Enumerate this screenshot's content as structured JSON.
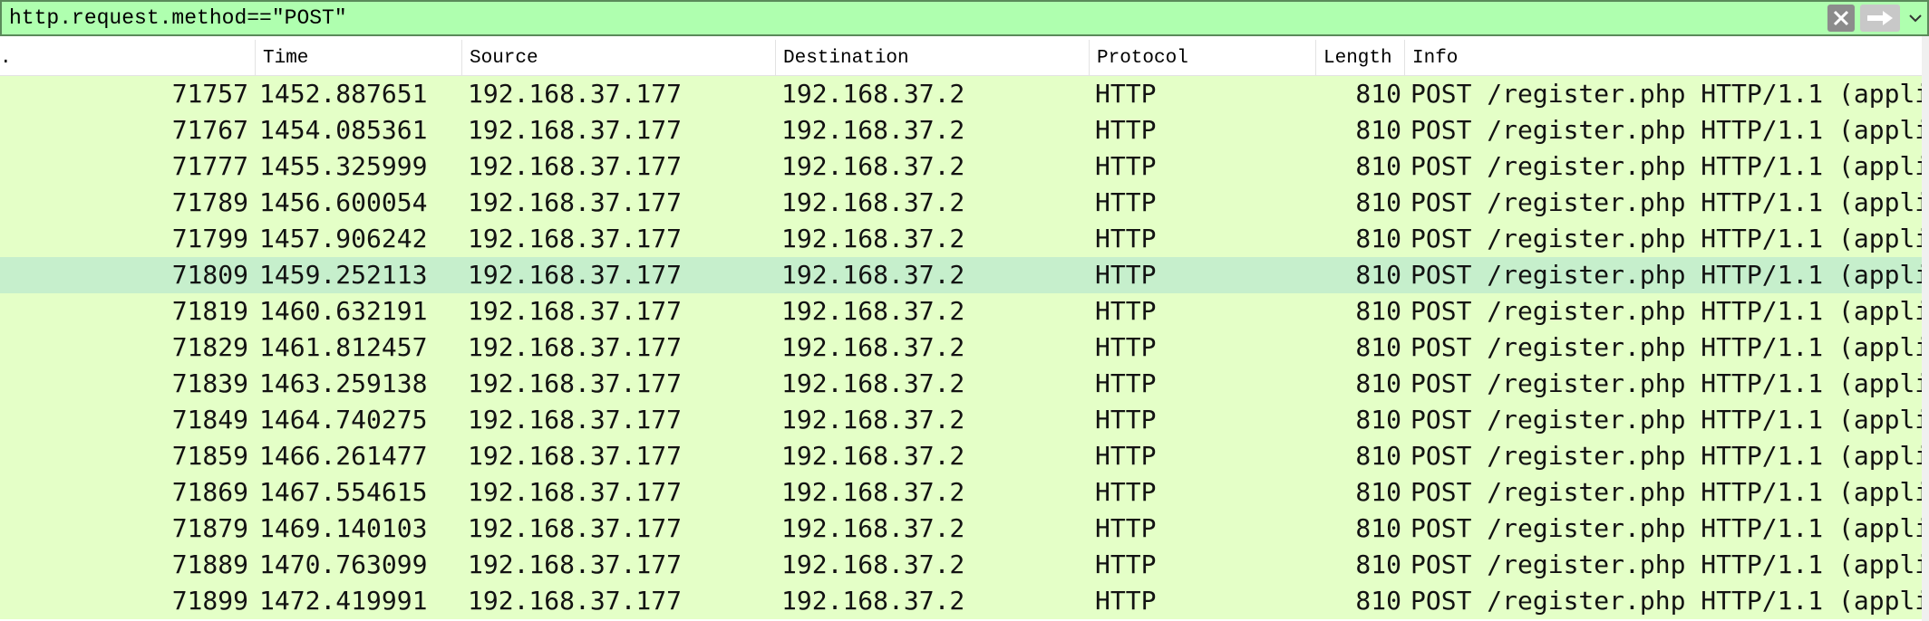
{
  "filter": {
    "value": "http.request.method==\"POST\""
  },
  "columns": [
    "No.",
    "Time",
    "Source",
    "Destination",
    "Protocol",
    "Length",
    "Info"
  ],
  "header_no_visible": ".",
  "selected_index": 5,
  "packets": [
    {
      "no": "71757",
      "time": "1452.887651",
      "source": "192.168.37.177",
      "destination": "192.168.37.2",
      "protocol": "HTTP",
      "length": "810",
      "info": "POST /register.php HTTP/1.1  (appli"
    },
    {
      "no": "71767",
      "time": "1454.085361",
      "source": "192.168.37.177",
      "destination": "192.168.37.2",
      "protocol": "HTTP",
      "length": "810",
      "info": "POST /register.php HTTP/1.1  (appli"
    },
    {
      "no": "71777",
      "time": "1455.325999",
      "source": "192.168.37.177",
      "destination": "192.168.37.2",
      "protocol": "HTTP",
      "length": "810",
      "info": "POST /register.php HTTP/1.1  (appli"
    },
    {
      "no": "71789",
      "time": "1456.600054",
      "source": "192.168.37.177",
      "destination": "192.168.37.2",
      "protocol": "HTTP",
      "length": "810",
      "info": "POST /register.php HTTP/1.1  (appli"
    },
    {
      "no": "71799",
      "time": "1457.906242",
      "source": "192.168.37.177",
      "destination": "192.168.37.2",
      "protocol": "HTTP",
      "length": "810",
      "info": "POST /register.php HTTP/1.1  (appli"
    },
    {
      "no": "71809",
      "time": "1459.252113",
      "source": "192.168.37.177",
      "destination": "192.168.37.2",
      "protocol": "HTTP",
      "length": "810",
      "info": "POST /register.php HTTP/1.1  (appli"
    },
    {
      "no": "71819",
      "time": "1460.632191",
      "source": "192.168.37.177",
      "destination": "192.168.37.2",
      "protocol": "HTTP",
      "length": "810",
      "info": "POST /register.php HTTP/1.1  (appli"
    },
    {
      "no": "71829",
      "time": "1461.812457",
      "source": "192.168.37.177",
      "destination": "192.168.37.2",
      "protocol": "HTTP",
      "length": "810",
      "info": "POST /register.php HTTP/1.1  (appli"
    },
    {
      "no": "71839",
      "time": "1463.259138",
      "source": "192.168.37.177",
      "destination": "192.168.37.2",
      "protocol": "HTTP",
      "length": "810",
      "info": "POST /register.php HTTP/1.1  (appli"
    },
    {
      "no": "71849",
      "time": "1464.740275",
      "source": "192.168.37.177",
      "destination": "192.168.37.2",
      "protocol": "HTTP",
      "length": "810",
      "info": "POST /register.php HTTP/1.1  (appli"
    },
    {
      "no": "71859",
      "time": "1466.261477",
      "source": "192.168.37.177",
      "destination": "192.168.37.2",
      "protocol": "HTTP",
      "length": "810",
      "info": "POST /register.php HTTP/1.1  (appli"
    },
    {
      "no": "71869",
      "time": "1467.554615",
      "source": "192.168.37.177",
      "destination": "192.168.37.2",
      "protocol": "HTTP",
      "length": "810",
      "info": "POST /register.php HTTP/1.1  (appli"
    },
    {
      "no": "71879",
      "time": "1469.140103",
      "source": "192.168.37.177",
      "destination": "192.168.37.2",
      "protocol": "HTTP",
      "length": "810",
      "info": "POST /register.php HTTP/1.1  (appli"
    },
    {
      "no": "71889",
      "time": "1470.763099",
      "source": "192.168.37.177",
      "destination": "192.168.37.2",
      "protocol": "HTTP",
      "length": "810",
      "info": "POST /register.php HTTP/1.1  (appli"
    },
    {
      "no": "71899",
      "time": "1472.419991",
      "source": "192.168.37.177",
      "destination": "192.168.37.2",
      "protocol": "HTTP",
      "length": "810",
      "info": "POST /register.php HTTP/1.1  (appli"
    }
  ],
  "icons": {
    "clear": "close-icon",
    "apply": "arrow-right-icon",
    "dropdown": "chevron-down-icon"
  }
}
